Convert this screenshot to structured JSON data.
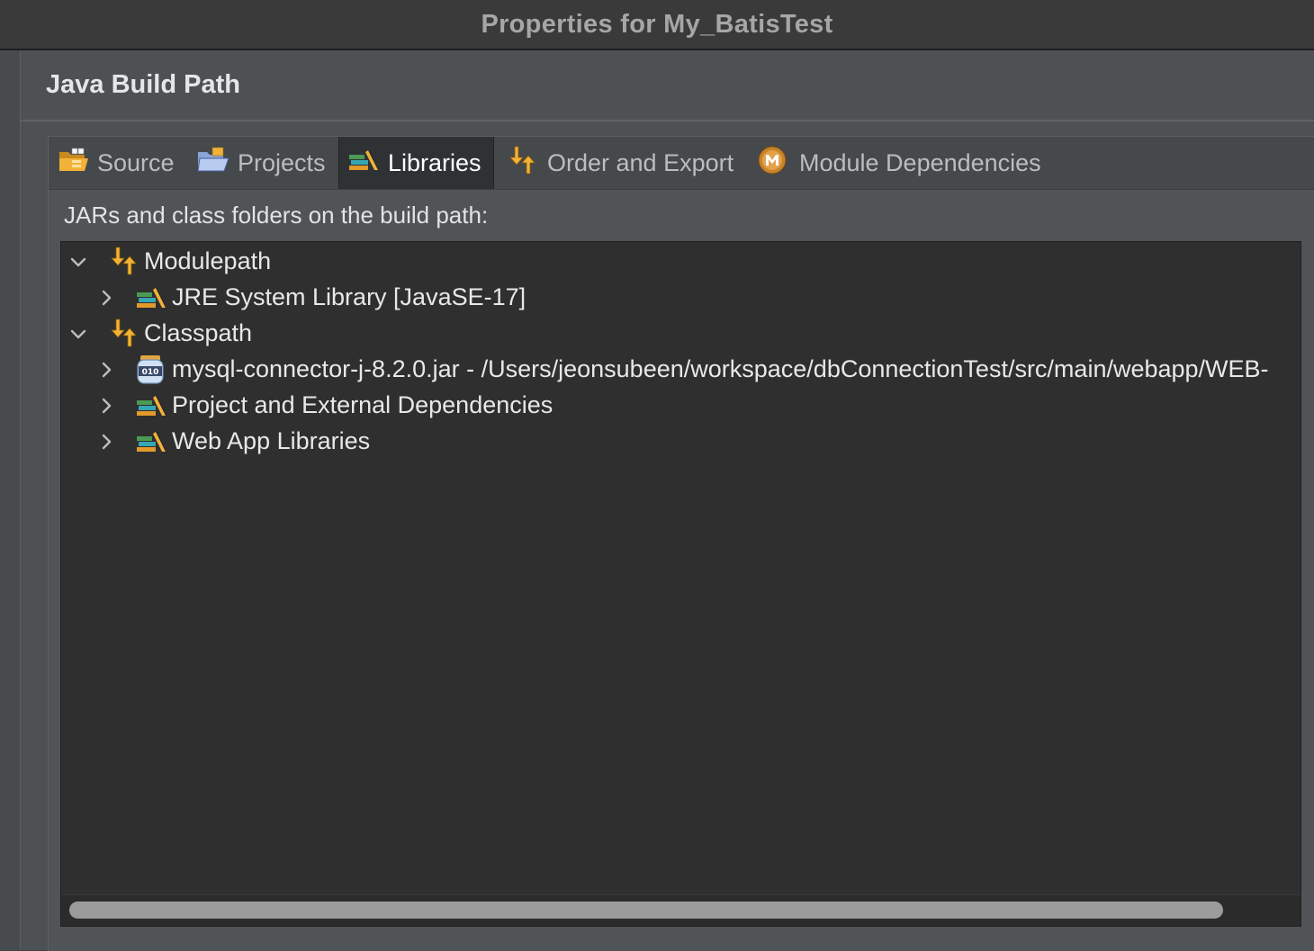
{
  "window": {
    "title": "Properties for My_BatisTest"
  },
  "page": {
    "title": "Java Build Path"
  },
  "tabs": [
    {
      "label": "Source",
      "icon": "folder-source-icon"
    },
    {
      "label": "Projects",
      "icon": "folder-projects-icon"
    },
    {
      "label": "Libraries",
      "icon": "library-icon",
      "active": true
    },
    {
      "label": "Order and Export",
      "icon": "order-arrows-icon"
    },
    {
      "label": "Module Dependencies",
      "icon": "module-m-icon"
    }
  ],
  "libraries": {
    "description": "JARs and class folders on the build path:",
    "tree": {
      "modulepath": {
        "label": "Modulepath",
        "expanded": true
      },
      "jre": {
        "label": "JRE System Library [JavaSE-17]",
        "expanded": false
      },
      "classpath": {
        "label": "Classpath",
        "expanded": true
      },
      "mysql": {
        "label": "mysql-connector-j-8.2.0.jar - /Users/jeonsubeen/workspace/dbConnectionTest/src/main/webapp/WEB-",
        "expanded": false
      },
      "project_deps": {
        "label": "Project and External Dependencies",
        "expanded": false
      },
      "webapp_libs": {
        "label": "Web App Libraries",
        "expanded": false
      }
    }
  },
  "colors": {
    "accent": "#f2b23a",
    "panel": "#2f2f2f",
    "background": "#4d5154"
  }
}
